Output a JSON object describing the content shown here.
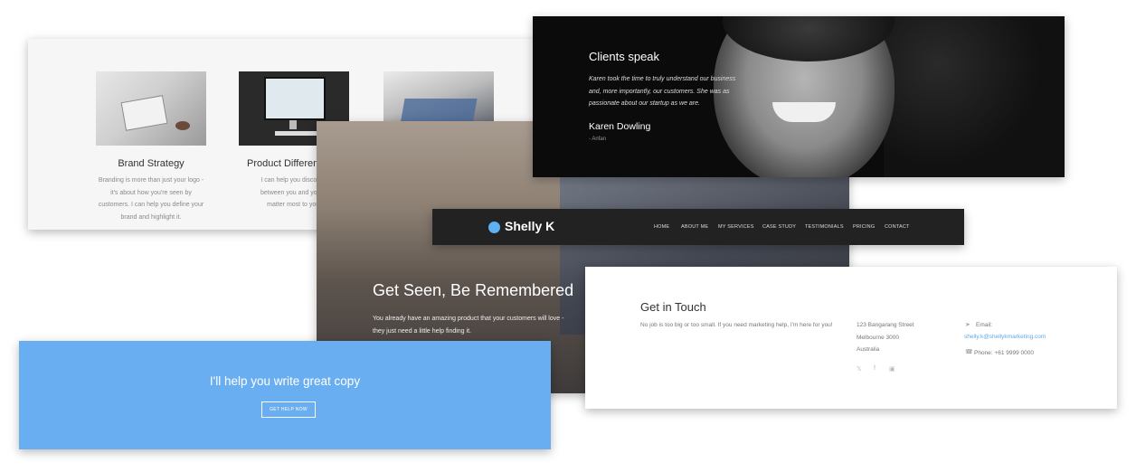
{
  "services": {
    "items": [
      {
        "title": "Brand Strategy",
        "lines": [
          "Branding is more than just your logo -",
          "it's about how you're seen by",
          "customers. I can help you define your",
          "brand and highlight it."
        ]
      },
      {
        "title": "Product Different",
        "lines": [
          "I can help you discover the",
          "between you and your com",
          "matter most to your cu"
        ]
      }
    ]
  },
  "hero": {
    "title": "Get Seen, Be Remembered",
    "subtitle_lines": [
      "You already have an amazing product that your customers will love -",
      "they just need a little help finding it."
    ]
  },
  "testimonial": {
    "heading": "Clients speak",
    "quote_lines": [
      "Karen took the time to truly understand our business",
      "and, more importantly, our customers. She was as",
      "passionate about our startup as we are."
    ],
    "name": "Karen Dowling",
    "company": "- Anfan"
  },
  "nav": {
    "brand": "Shelly K",
    "items": [
      "HOME",
      "ABOUT ME",
      "MY SERVICES",
      "CASE STUDY",
      "TESTIMONIALS",
      "PRICING",
      "CONTACT"
    ]
  },
  "cta": {
    "title": "I'll help you write great copy",
    "button": "GET HELP NOW"
  },
  "contact": {
    "title": "Get in Touch",
    "description": "No job is too big or too small. If you need marketing help, I'm here for you!",
    "address_lines": [
      "123 Bangarang Street",
      "Melbourne 3000",
      "Australia"
    ],
    "social": [
      "twitter-icon",
      "facebook-icon",
      "instagram-icon"
    ],
    "email_label": "Email:",
    "email": "shelly.k@shellykmarketing.com",
    "phone": "Phone: +61 9999 0000"
  },
  "colors": {
    "accent": "#6aaef2",
    "link": "#5fa8e8",
    "nav_bg": "#222222"
  }
}
